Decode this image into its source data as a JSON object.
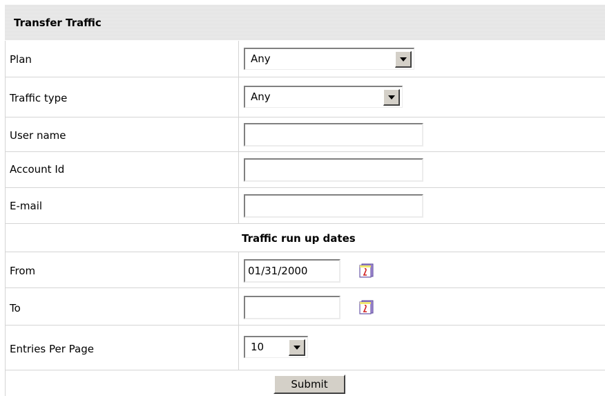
{
  "header": {
    "title": "Transfer Traffic"
  },
  "fields": {
    "plan": {
      "label": "Plan",
      "value": "Any"
    },
    "traffic_type": {
      "label": "Traffic type",
      "value": "Any"
    },
    "user_name": {
      "label": "User name",
      "value": "",
      "placeholder": ""
    },
    "account_id": {
      "label": "Account Id",
      "value": "",
      "placeholder": ""
    },
    "email": {
      "label": "E-mail",
      "value": "",
      "placeholder": ""
    }
  },
  "section": {
    "title": "Traffic run up dates"
  },
  "dates": {
    "from": {
      "label": "From",
      "value": "01/31/2000"
    },
    "to": {
      "label": "To",
      "value": ""
    }
  },
  "entries_per_page": {
    "label": "Entries Per Page",
    "value": "10"
  },
  "submit_label": "Submit",
  "icons": {
    "calendar": "calendar-icon",
    "dropdown": "chevron-down-icon"
  },
  "colors": {
    "header_bg": "#e6e6e6",
    "border": "#d4d4d4",
    "button_face": "#d4d0c8"
  }
}
